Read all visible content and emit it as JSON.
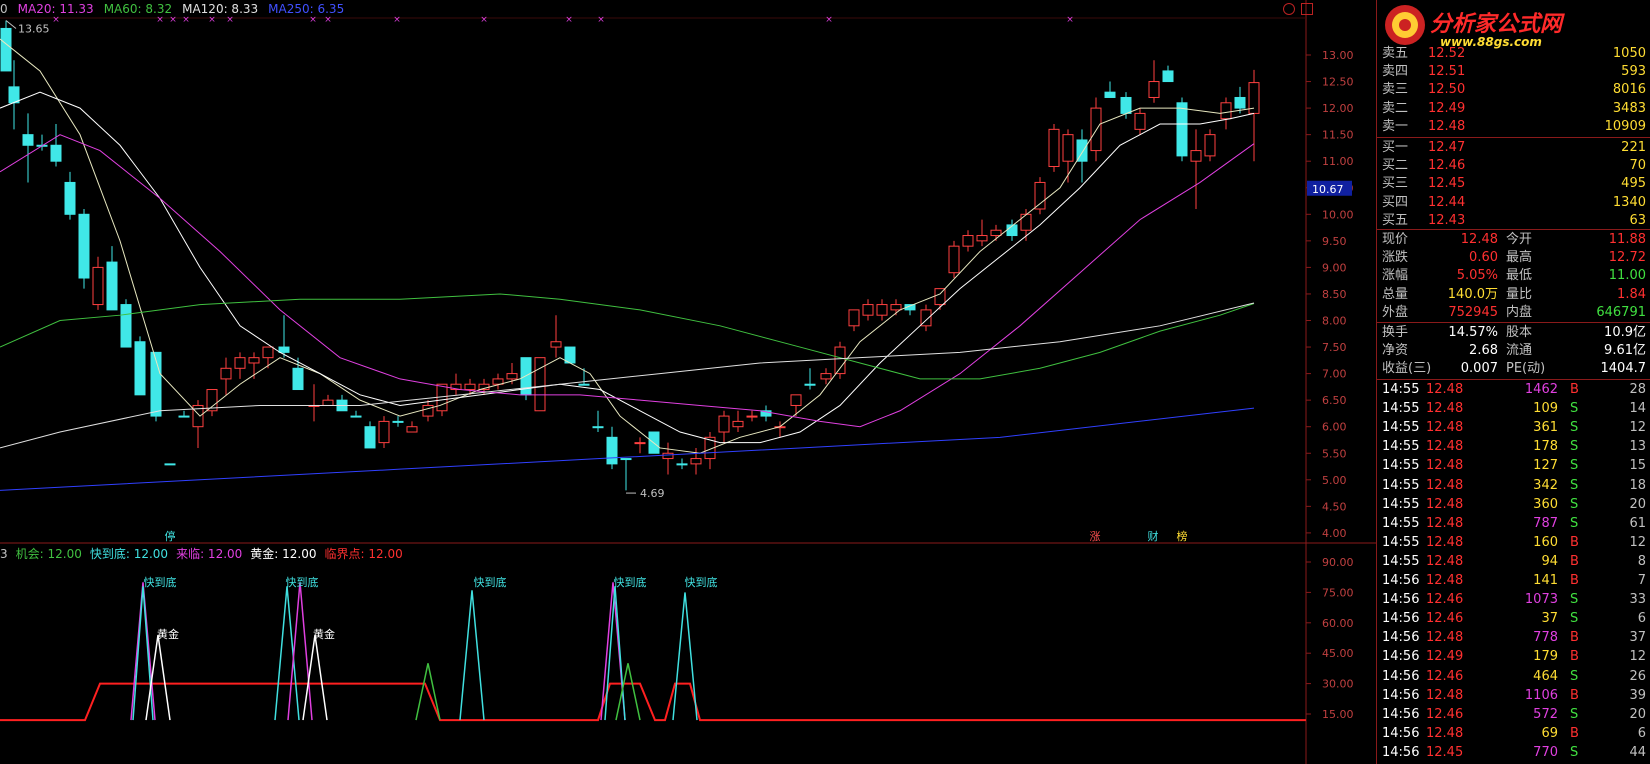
{
  "ma_legend": [
    {
      "label": "MA20: 11.33",
      "color": "#e040e0"
    },
    {
      "label": "MA60: 8.32",
      "color": "#40c040"
    },
    {
      "label": "MA120: 8.33",
      "color": "#e0e0e0"
    },
    {
      "label": "MA250: 6.35",
      "color": "#4050ff"
    }
  ],
  "ind_legend": [
    {
      "label": "机会: 12.00",
      "color": "#40c040"
    },
    {
      "label": "快到底: 12.00",
      "color": "#40e0e0"
    },
    {
      "label": "来临: 12.00",
      "color": "#e040e0"
    },
    {
      "label": "黄金: 12.00",
      "color": "#ffffff"
    },
    {
      "label": "临界点: 12.00",
      "color": "#ff3030"
    }
  ],
  "annotations": {
    "high": "13.65",
    "low": "4.69",
    "current_price_tag": "10.67"
  },
  "price_axis": [
    "13.00",
    "12.50",
    "12.00",
    "11.50",
    "11.00",
    "10.50",
    "10.00",
    "9.50",
    "9.00",
    "8.50",
    "8.00",
    "7.50",
    "7.00",
    "6.50",
    "6.00",
    "5.50",
    "5.00",
    "4.50",
    "4.00"
  ],
  "ind_axis": [
    "90.00",
    "75.00",
    "60.00",
    "45.00",
    "30.00",
    "15.00"
  ],
  "bottom_tags": [
    {
      "label": "停",
      "color": "#40e0e0"
    },
    {
      "label": "涨",
      "color": "#ff5050"
    },
    {
      "label": "财",
      "color": "#40e0e0"
    },
    {
      "label": "榜",
      "color": "#ffdd33"
    }
  ],
  "ind_labels": [
    {
      "text": "快到底",
      "color": "#40e0e0"
    },
    {
      "text": "黄金",
      "color": "#ffffff"
    },
    {
      "text": "快到底",
      "color": "#40e0e0"
    },
    {
      "text": "黄金",
      "color": "#ffffff"
    },
    {
      "text": "快到底",
      "color": "#40e0e0"
    },
    {
      "text": "快到底",
      "color": "#40e0e0"
    },
    {
      "text": "快到底",
      "color": "#40e0e0"
    }
  ],
  "logo": {
    "title": "分析家公式网",
    "url": "www.88gs.com"
  },
  "sell_orders": [
    {
      "label": "卖五",
      "price": "12.52",
      "vol": "1050"
    },
    {
      "label": "卖四",
      "price": "12.51",
      "vol": "593"
    },
    {
      "label": "卖三",
      "price": "12.50",
      "vol": "8016"
    },
    {
      "label": "卖二",
      "price": "12.49",
      "vol": "3483"
    },
    {
      "label": "卖一",
      "price": "12.48",
      "vol": "10909"
    }
  ],
  "buy_orders": [
    {
      "label": "买一",
      "price": "12.47",
      "vol": "221"
    },
    {
      "label": "买二",
      "price": "12.46",
      "vol": "70"
    },
    {
      "label": "买三",
      "price": "12.45",
      "vol": "495"
    },
    {
      "label": "买四",
      "price": "12.44",
      "vol": "1340"
    },
    {
      "label": "买五",
      "price": "12.43",
      "vol": "63"
    }
  ],
  "quote": [
    {
      "l1": "现价",
      "v1": "12.48",
      "c1": "#ff3030",
      "l2": "今开",
      "v2": "11.88",
      "c2": "#ff3030"
    },
    {
      "l1": "涨跌",
      "v1": "0.60",
      "c1": "#ff3030",
      "l2": "最高",
      "v2": "12.72",
      "c2": "#ff3030"
    },
    {
      "l1": "涨幅",
      "v1": "5.05%",
      "c1": "#ff3030",
      "l2": "最低",
      "v2": "11.00",
      "c2": "#40e040"
    },
    {
      "l1": "总量",
      "v1": "140.0万",
      "c1": "#ffdd33",
      "l2": "量比",
      "v2": "1.84",
      "c2": "#ff3030"
    },
    {
      "l1": "外盘",
      "v1": "752945",
      "c1": "#ff3030",
      "l2": "内盘",
      "v2": "646791",
      "c2": "#40e040"
    }
  ],
  "fundamentals": [
    {
      "l1": "换手",
      "v1": "14.57%",
      "l2": "股本",
      "v2": "10.9亿"
    },
    {
      "l1": "净资",
      "v1": "2.68",
      "l2": "流通",
      "v2": "9.61亿"
    },
    {
      "l1": "收益(三)",
      "v1": "0.007",
      "l2": "PE(动)",
      "v2": "1404.7"
    }
  ],
  "ticks": [
    {
      "time": "14:55",
      "price": "12.48",
      "vol": "1462",
      "side": "B",
      "n": "28"
    },
    {
      "time": "14:55",
      "price": "12.48",
      "vol": "109",
      "side": "S",
      "n": "14"
    },
    {
      "time": "14:55",
      "price": "12.48",
      "vol": "361",
      "side": "S",
      "n": "12"
    },
    {
      "time": "14:55",
      "price": "12.48",
      "vol": "178",
      "side": "S",
      "n": "13"
    },
    {
      "time": "14:55",
      "price": "12.48",
      "vol": "127",
      "side": "S",
      "n": "15"
    },
    {
      "time": "14:55",
      "price": "12.48",
      "vol": "342",
      "side": "S",
      "n": "18"
    },
    {
      "time": "14:55",
      "price": "12.48",
      "vol": "360",
      "side": "S",
      "n": "20"
    },
    {
      "time": "14:55",
      "price": "12.48",
      "vol": "787",
      "side": "S",
      "n": "61"
    },
    {
      "time": "14:55",
      "price": "12.48",
      "vol": "160",
      "side": "B",
      "n": "12"
    },
    {
      "time": "14:55",
      "price": "12.48",
      "vol": "94",
      "side": "B",
      "n": "8"
    },
    {
      "time": "14:56",
      "price": "12.48",
      "vol": "141",
      "side": "B",
      "n": "7"
    },
    {
      "time": "14:56",
      "price": "12.46",
      "vol": "1073",
      "side": "S",
      "n": "33"
    },
    {
      "time": "14:56",
      "price": "12.46",
      "vol": "37",
      "side": "S",
      "n": "6"
    },
    {
      "time": "14:56",
      "price": "12.48",
      "vol": "778",
      "side": "B",
      "n": "37"
    },
    {
      "time": "14:56",
      "price": "12.49",
      "vol": "179",
      "side": "B",
      "n": "12"
    },
    {
      "time": "14:56",
      "price": "12.46",
      "vol": "464",
      "side": "S",
      "n": "26"
    },
    {
      "time": "14:56",
      "price": "12.48",
      "vol": "1106",
      "side": "B",
      "n": "39"
    },
    {
      "time": "14:56",
      "price": "12.46",
      "vol": "572",
      "side": "S",
      "n": "20"
    },
    {
      "time": "14:56",
      "price": "12.48",
      "vol": "69",
      "side": "B",
      "n": "6"
    },
    {
      "time": "14:56",
      "price": "12.45",
      "vol": "770",
      "side": "S",
      "n": "44"
    }
  ]
}
